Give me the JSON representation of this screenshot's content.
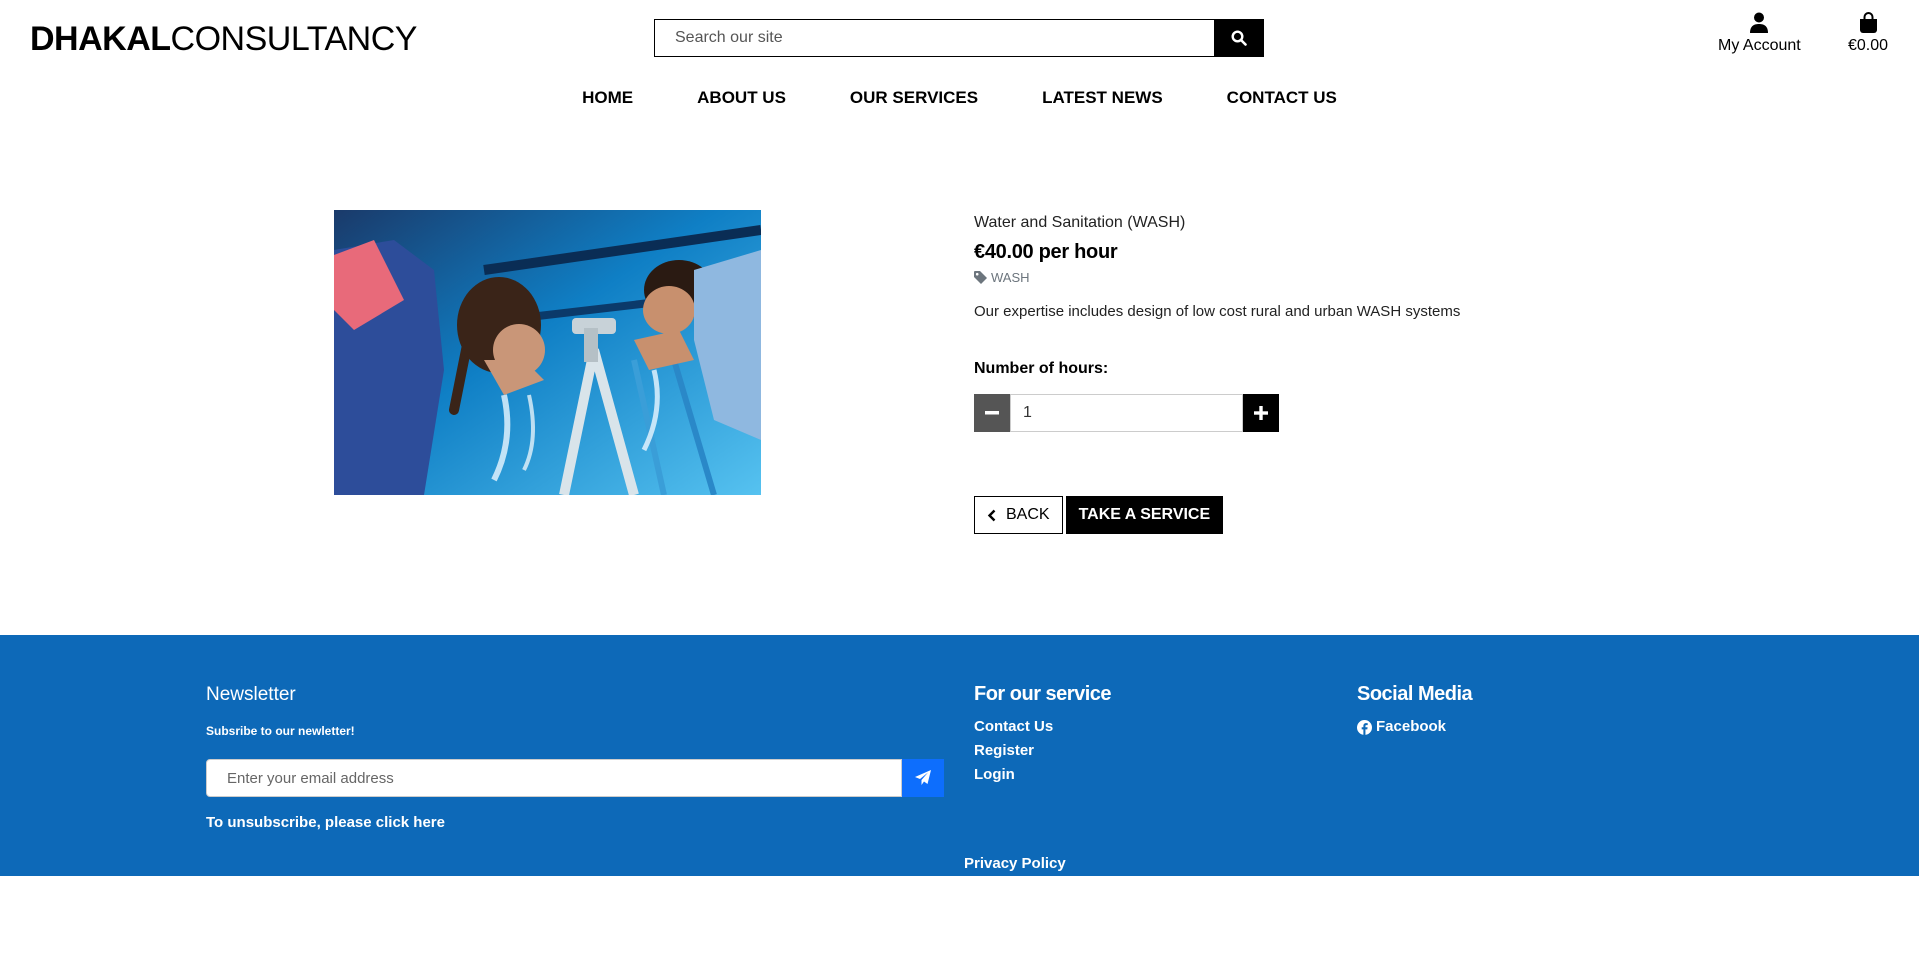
{
  "header": {
    "logo_bold": "DHAKAL",
    "logo_light": "CONSULTANCY",
    "search_placeholder": "Search our site",
    "account_label": "My Account",
    "bag_total": "€0.00"
  },
  "nav": {
    "items": [
      "HOME",
      "ABOUT US",
      "OUR SERVICES",
      "LATEST NEWS",
      "CONTACT US"
    ]
  },
  "product": {
    "name": "Water and Sanitation (WASH)",
    "price": "€40.00 per hour",
    "tag": "WASH",
    "description": "Our expertise includes design of low cost rural and urban WASH systems",
    "qty_label": "Number of hours:",
    "qty_value": "1",
    "back_label": "BACK",
    "take_label": "TAKE A SERVICE"
  },
  "footer": {
    "newsletter_title": "Newsletter",
    "newsletter_sub": "Subsribe to our newletter!",
    "email_placeholder": "Enter your email address",
    "unsubscribe": "To unsubscribe, please click here",
    "service_title": "For our service",
    "service_links": [
      "Contact Us",
      "Register",
      "Login"
    ],
    "social_title": "Social Media",
    "social_facebook": "Facebook",
    "privacy": "Privacy Policy"
  },
  "colors": {
    "footer_bg": "#0d69b8",
    "send_button": "#0d6efd",
    "minus_button": "#555555"
  },
  "icons": [
    "search-icon",
    "user-icon",
    "shopping-bag-icon",
    "tag-icon",
    "minus-icon",
    "plus-icon",
    "chevron-left-icon",
    "paper-plane-icon",
    "facebook-icon"
  ]
}
